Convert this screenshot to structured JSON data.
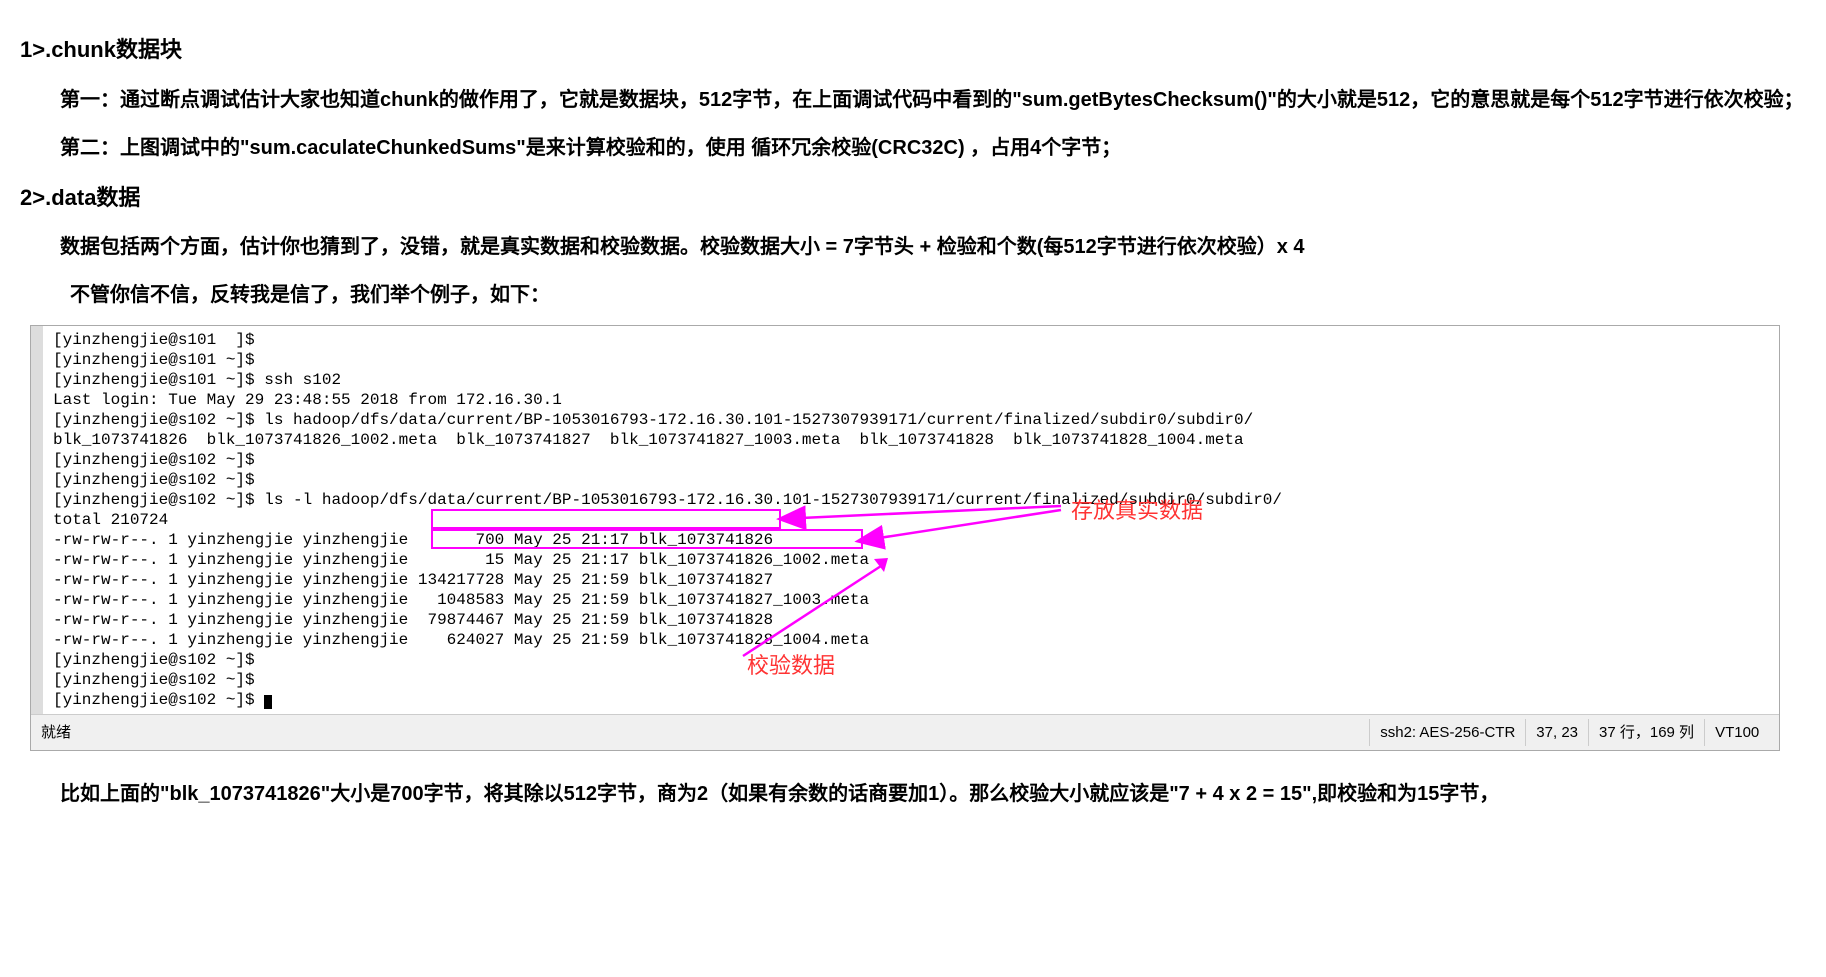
{
  "heading1": "1>.chunk数据块",
  "para1": "第一：通过断点调试估计大家也知道chunk的做作用了，它就是数据块，512字节，在上面调试代码中看到的\"sum.getBytesChecksum()\"的大小就是512，它的意思就是每个512字节进行依次校验；",
  "para2": "第二：上图调试中的\"sum.caculateChunkedSums\"是来计算校验和的，使用 循环冗余校验(CRC32C) ，占用4个字节；",
  "heading2": "2>.data数据",
  "para3": "数据包括两个方面，估计你也猜到了，没错，就是真实数据和校验数据。校验数据大小 = 7字节头 + 检验和个数(每512字节进行依次校验）x 4",
  "para4": "不管你信不信，反转我是信了，我们举个例子，如下：",
  "terminal": {
    "lines": [
      "[yinzhengjie@s101  ]$",
      "[yinzhengjie@s101 ~]$",
      "[yinzhengjie@s101 ~]$ ssh s102",
      "Last login: Tue May 29 23:48:55 2018 from 172.16.30.1",
      "[yinzhengjie@s102 ~]$ ls hadoop/dfs/data/current/BP-1053016793-172.16.30.101-1527307939171/current/finalized/subdir0/subdir0/",
      "blk_1073741826  blk_1073741826_1002.meta  blk_1073741827  blk_1073741827_1003.meta  blk_1073741828  blk_1073741828_1004.meta",
      "[yinzhengjie@s102 ~]$",
      "[yinzhengjie@s102 ~]$",
      "[yinzhengjie@s102 ~]$ ls -l hadoop/dfs/data/current/BP-1053016793-172.16.30.101-1527307939171/current/finalized/subdir0/subdir0/",
      "total 210724",
      "-rw-rw-r--. 1 yinzhengjie yinzhengjie       700 May 25 21:17 blk_1073741826",
      "-rw-rw-r--. 1 yinzhengjie yinzhengjie        15 May 25 21:17 blk_1073741826_1002.meta",
      "-rw-rw-r--. 1 yinzhengjie yinzhengjie 134217728 May 25 21:59 blk_1073741827",
      "-rw-rw-r--. 1 yinzhengjie yinzhengjie   1048583 May 25 21:59 blk_1073741827_1003.meta",
      "-rw-rw-r--. 1 yinzhengjie yinzhengjie  79874467 May 25 21:59 blk_1073741828",
      "-rw-rw-r--. 1 yinzhengjie yinzhengjie    624027 May 25 21:59 blk_1073741828_1004.meta",
      "[yinzhengjie@s102 ~]$",
      "[yinzhengjie@s102 ~]$",
      "[yinzhengjie@s102 ~]$ "
    ]
  },
  "annotations": {
    "real_data": "存放真实数据",
    "check_data": "校验数据"
  },
  "status": {
    "left": "就绪",
    "ssh": "ssh2: AES-256-CTR",
    "pos": "37, 23",
    "rows": "37 行，169 列",
    "term": "VT100"
  },
  "para5": "比如上面的\"blk_1073741826\"大小是700字节，将其除以512字节，商为2（如果有余数的话商要加1）。那么校验大小就应该是\"7 + 4 x 2 = 15\",即校验和为15字节，"
}
